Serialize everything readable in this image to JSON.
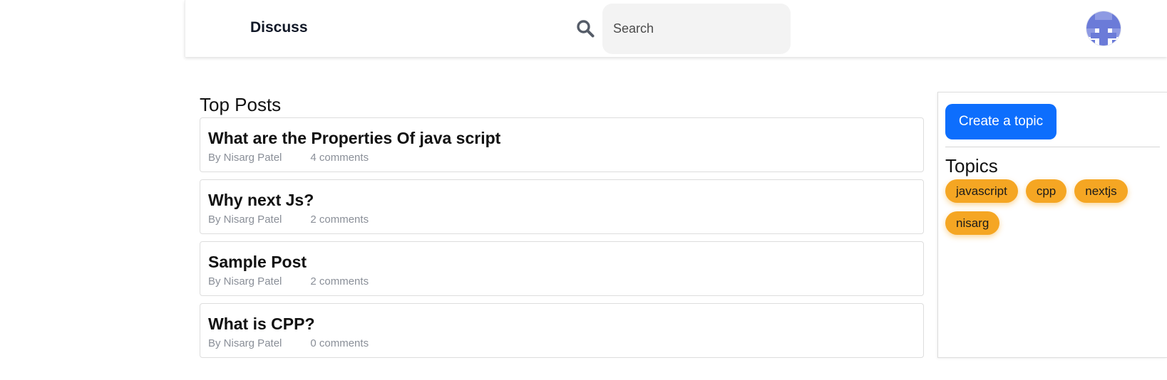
{
  "header": {
    "brand": "Discuss",
    "search_placeholder": "Search",
    "avatar_colors": {
      "primary": "#6b7bd8",
      "background": "#ffffff"
    }
  },
  "main": {
    "title": "Top Posts",
    "posts": [
      {
        "title": "What are the Properties Of java script",
        "author": "By Nisarg Patel",
        "comments": "4 comments"
      },
      {
        "title": "Why next Js?",
        "author": "By Nisarg Patel",
        "comments": "2 comments"
      },
      {
        "title": "Sample Post",
        "author": "By Nisarg Patel",
        "comments": "2 comments"
      },
      {
        "title": "What is CPP?",
        "author": "By Nisarg Patel",
        "comments": "0 comments"
      }
    ]
  },
  "sidebar": {
    "create_label": "Create a topic",
    "topics_title": "Topics",
    "topics": [
      "javascript",
      "cpp",
      "nextjs",
      "nisarg"
    ]
  },
  "colors": {
    "accent": "#0d6efd",
    "chip": "#f5a623",
    "muted_text": "#8a8f98"
  }
}
